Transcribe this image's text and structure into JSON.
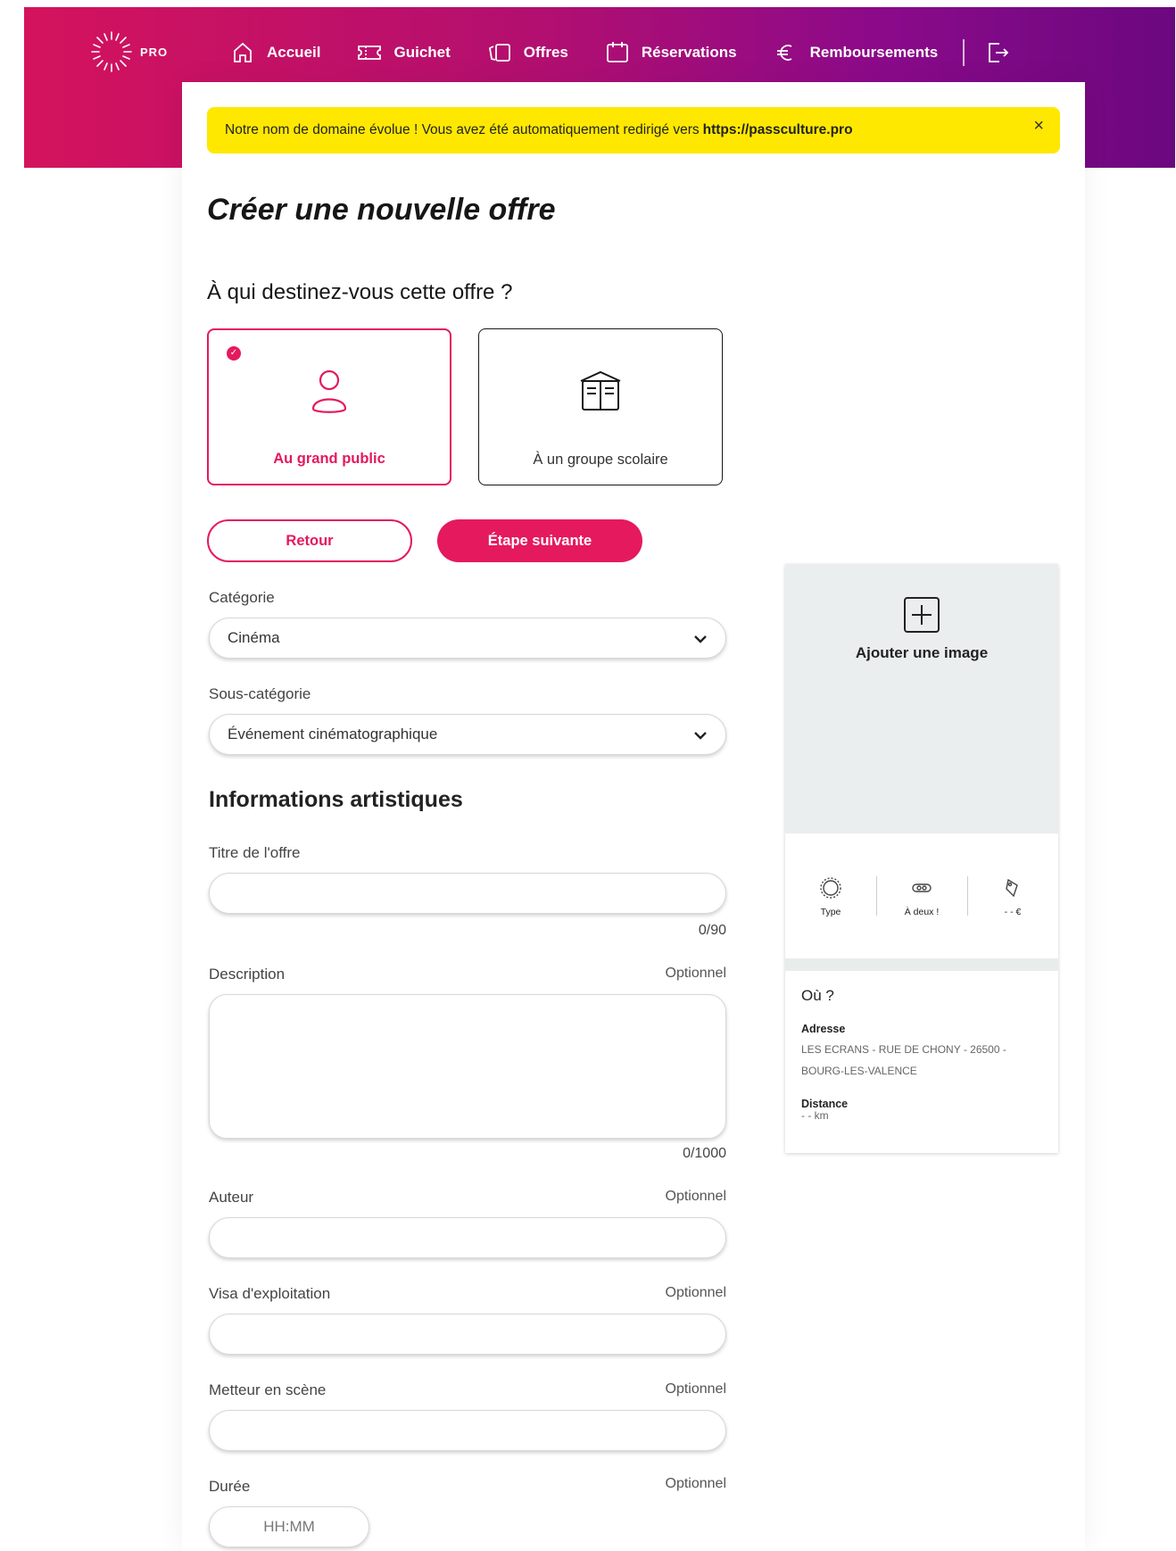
{
  "header": {
    "logo_text": "PRO",
    "nav": [
      {
        "label": "Accueil",
        "icon": "home-icon"
      },
      {
        "label": "Guichet",
        "icon": "ticket-icon"
      },
      {
        "label": "Offres",
        "icon": "offers-icon"
      },
      {
        "label": "Réservations",
        "icon": "calendar-icon"
      },
      {
        "label": "Remboursements",
        "icon": "euro-icon"
      }
    ],
    "logout_icon": "logout-icon",
    "gradient": [
      "#d4135d",
      "#6c087f"
    ]
  },
  "banner": {
    "text": "Notre nom de domaine évolue ! Vous avez été automatiquement redirigé vers",
    "link": "https://passculture.pro",
    "close": "×"
  },
  "page_title": "Créer une nouvelle offre",
  "audience": {
    "title": "À qui destinez-vous cette offre ?",
    "options": [
      {
        "label": "Au grand public",
        "selected": true,
        "icon": "user-icon"
      },
      {
        "label": "À un groupe scolaire",
        "selected": false,
        "icon": "book-icon"
      }
    ]
  },
  "actions": {
    "back": "Retour",
    "next": "Étape suivante"
  },
  "form": {
    "category_label": "Catégorie",
    "category_value": "Cinéma",
    "subcategory_label": "Sous-catégorie",
    "subcategory_value": "Événement cinématographique",
    "section_heading": "Informations artistiques",
    "title_label": "Titre de l'offre",
    "title_counter": "0/90",
    "description_label": "Description",
    "description_counter": "0/1000",
    "optional": "Optionnel",
    "author_label": "Auteur",
    "visa_label": "Visa d'exploitation",
    "director_label": "Metteur en scène",
    "duration_label": "Durée",
    "duration_placeholder": "HH:MM"
  },
  "preview": {
    "add_image": "Ajouter une image",
    "stats": [
      {
        "label": "Type",
        "icon": "type-icon"
      },
      {
        "label": "À deux !",
        "icon": "duo-icon"
      },
      {
        "label": "- - €",
        "icon": "price-icon"
      }
    ],
    "where_title": "Où ?",
    "address_label": "Adresse",
    "address_value": "LES ECRANS - RUE DE CHONY - 26500 - BOURG-LES-VALENCE",
    "distance_label": "Distance",
    "distance_value": "- - km"
  },
  "colors": {
    "accent": "#e5195e",
    "banner": "#ffe800"
  }
}
